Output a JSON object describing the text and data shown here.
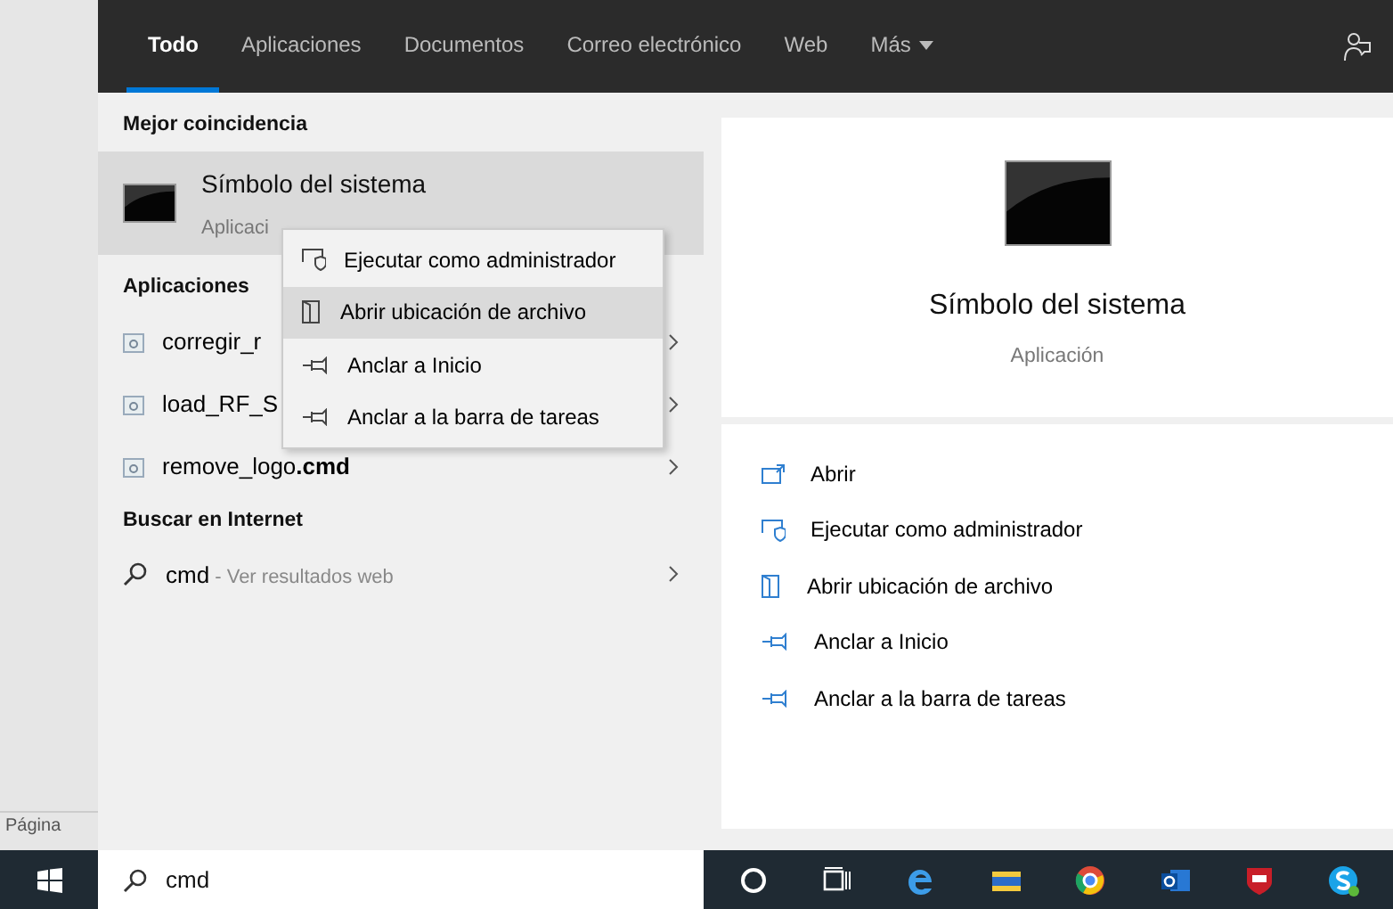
{
  "tabs": [
    {
      "label": "Todo",
      "selected": true
    },
    {
      "label": "Aplicaciones",
      "selected": false
    },
    {
      "label": "Documentos",
      "selected": false
    },
    {
      "label": "Correo electrónico",
      "selected": false
    },
    {
      "label": "Web",
      "selected": false
    },
    {
      "label": "Más",
      "selected": false,
      "kind": "menu"
    }
  ],
  "best_match": {
    "heading": "Mejor coincidencia",
    "title": "Símbolo del sistema",
    "subtitle": "Aplicaci",
    "selected": true
  },
  "apps": {
    "heading": "Aplicaciones",
    "items": [
      {
        "name": "corregir_r"
      },
      {
        "name": "load_RF_S"
      },
      {
        "name": "remove_logo**.cmd**"
      }
    ]
  },
  "web": {
    "heading": "Buscar en Internet",
    "query": "cmd",
    "suffix": "- Ver resultados web"
  },
  "context_menu": [
    {
      "kind": "admin",
      "label": "Ejecutar como administrador",
      "selected": false
    },
    {
      "kind": "folder",
      "label": "Abrir ubicación de archivo",
      "selected": true
    },
    {
      "kind": "pin",
      "label": "Anclar a Inicio",
      "selected": false
    },
    {
      "kind": "pin",
      "label": "Anclar a la barra de tareas",
      "selected": false
    }
  ],
  "preview": {
    "title": "Símbolo del sistema",
    "subtitle": "Aplicación",
    "actions": [
      {
        "kind": "open",
        "label": "Abrir"
      },
      {
        "kind": "admin",
        "label": "Ejecutar como administrador"
      },
      {
        "kind": "folder",
        "label": "Abrir ubicación de archivo"
      },
      {
        "kind": "pin",
        "label": "Anclar a Inicio"
      },
      {
        "kind": "pin",
        "label": "Anclar a la barra de tareas"
      }
    ]
  },
  "background_label": "Página",
  "taskbar": {
    "search_text": "cmd"
  }
}
